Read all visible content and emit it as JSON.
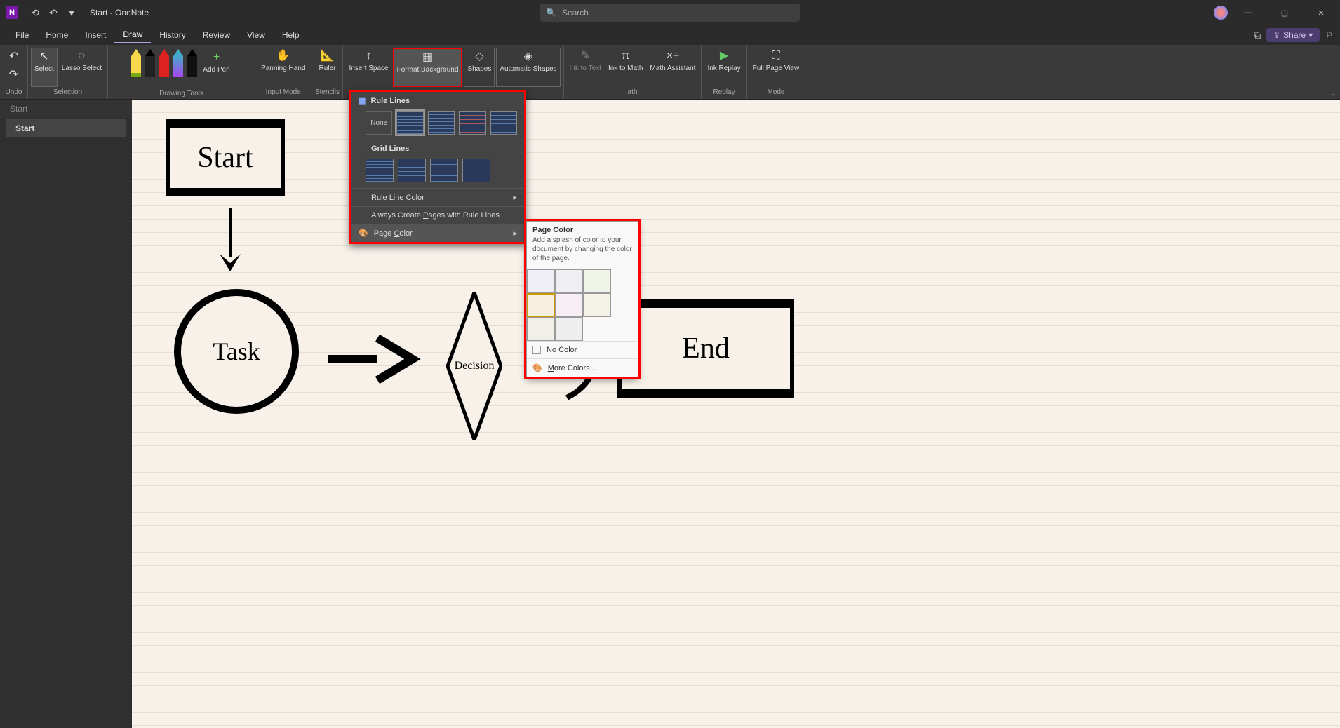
{
  "titlebar": {
    "app_letter": "N",
    "doc_title": "Start - OneNote",
    "search_placeholder": "Search"
  },
  "menutabs": {
    "items": [
      "File",
      "Home",
      "Insert",
      "Draw",
      "History",
      "Review",
      "View",
      "Help"
    ],
    "active_index": 3,
    "share_label": "Share"
  },
  "ribbon": {
    "undo_group_label": "Undo",
    "select_label": "Select",
    "lasso_label": "Lasso Select",
    "selection_group_label": "Selection",
    "drawing_group_label": "Drawing Tools",
    "addpen_label": "Add Pen",
    "panning_label": "Panning Hand",
    "inputmode_group_label": "Input Mode",
    "ruler_label": "Ruler",
    "stencils_group_label": "Stencils",
    "insertspace_label": "Insert Space",
    "formatbg_label": "Format Background",
    "shapes_label": "Shapes",
    "autoshapes_label": "Automatic Shapes",
    "inktext_label": "Ink to Text",
    "inkmath_label": "Ink to Math",
    "mathassist_label": "Math Assistant",
    "ath_group_label": "ath",
    "inkreplay_label": "Ink Replay",
    "replay_group_label": "Replay",
    "fullpage_label": "Full Page View",
    "mode_group_label": "Mode"
  },
  "pagelist": {
    "items": [
      {
        "label": "Start",
        "active": false
      },
      {
        "label": "Start",
        "active": true
      }
    ]
  },
  "canvas": {
    "shapes": {
      "start": "Start",
      "task": "Task",
      "decision": "Decision",
      "end": "End"
    }
  },
  "popup": {
    "rule_lines_label": "Rule Lines",
    "none_label": "None",
    "grid_lines_label": "Grid Lines",
    "rule_color_label": "Rule Line Color",
    "always_label": "Always Create Pages with Rule Lines",
    "page_color_label": "Page Color"
  },
  "flyout": {
    "title": "Page Color",
    "desc": "Add a splash of color to your document by changing the color of the page.",
    "nocolor_label": "No Color",
    "morecolors_label": "More Colors...",
    "colors": [
      "#f0eef7",
      "#efeef2",
      "#eef5e8",
      "#f7efe0",
      "#f6eef4",
      "#f5f2e8",
      "#f0f0e8",
      "#eeeeee"
    ]
  }
}
